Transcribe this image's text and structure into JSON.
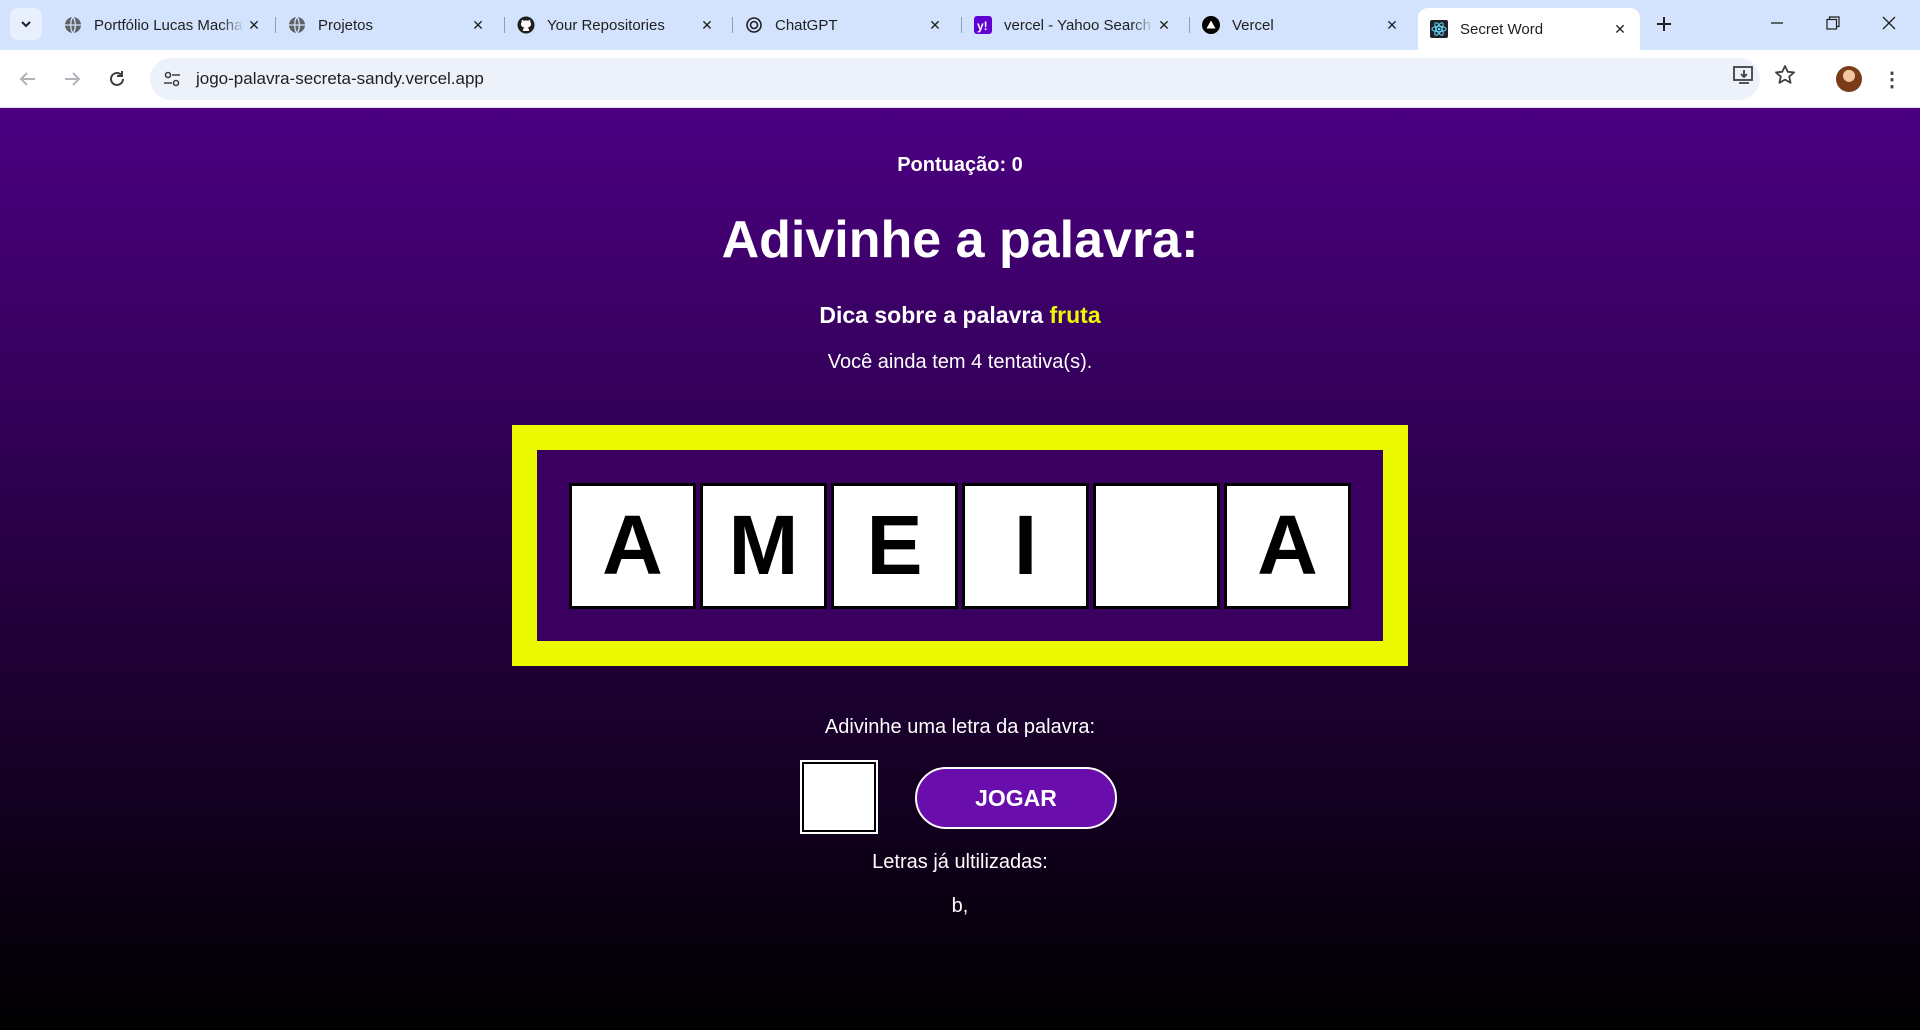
{
  "browser": {
    "tabs": [
      {
        "title": "Portfólio Lucas Machado",
        "icon": "globe-icon"
      },
      {
        "title": "Projetos",
        "icon": "globe-icon"
      },
      {
        "title": "Your Repositories",
        "icon": "github-icon"
      },
      {
        "title": "ChatGPT",
        "icon": "chatgpt-icon"
      },
      {
        "title": "vercel - Yahoo Search",
        "icon": "yahoo-icon"
      },
      {
        "title": "Vercel",
        "icon": "vercel-icon"
      },
      {
        "title": "Secret Word",
        "icon": "react-icon",
        "active": true
      }
    ],
    "url": "jogo-palavra-secreta-sandy.vercel.app"
  },
  "game": {
    "score_label": "Pontuação: 0",
    "heading": "Adivinhe a palavra:",
    "hint_prefix": "Dica sobre a palavra",
    "hint_value": "fruta",
    "attempts_text": "Você ainda tem 4 tentativa(s).",
    "letters": [
      "A",
      "M",
      "E",
      "I",
      "",
      "A"
    ],
    "guess_label": "Adivinhe uma letra da palavra:",
    "guess_value": "",
    "play_button": "JOGAR",
    "used_label": "Letras já ultilizadas:",
    "used_letters": "b,"
  },
  "colors": {
    "page_top": "#4b0082",
    "page_bottom": "#000000",
    "accent_yellow": "#ecfa00",
    "button_purple": "#6a0dad"
  }
}
